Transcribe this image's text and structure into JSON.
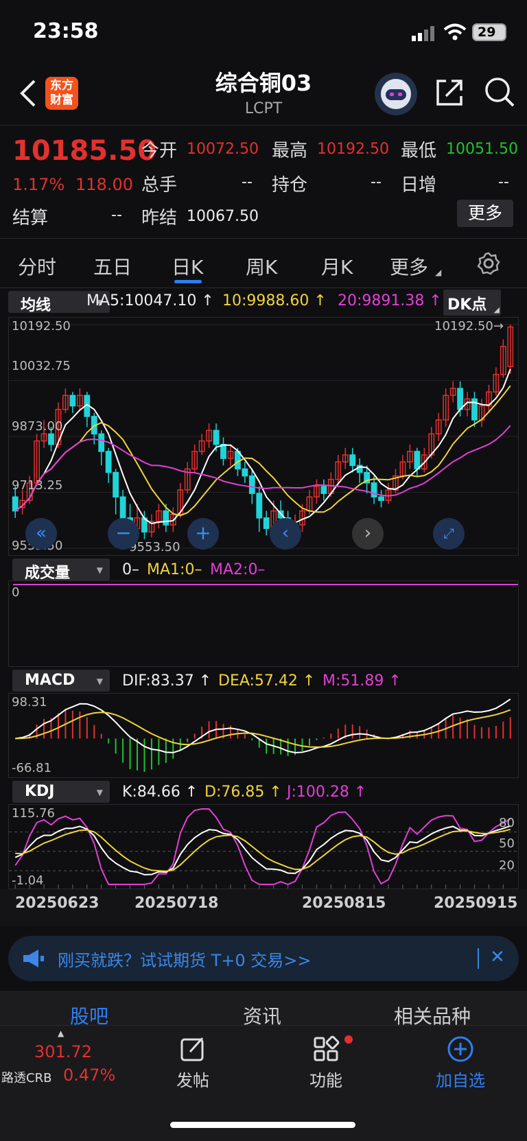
{
  "status": {
    "time": "23:58",
    "battery": "29"
  },
  "header": {
    "title": "综合铜03",
    "subtitle": "LCPT",
    "logo_line1": "东方",
    "logo_line2": "财富"
  },
  "quote": {
    "price": "10185.50",
    "change_pct": "1.17%",
    "change": "118.00",
    "open_label": "今开",
    "open": "10072.50",
    "high_label": "最高",
    "high": "10192.50",
    "low_label": "最低",
    "low": "10051.50",
    "volume_label": "总手",
    "volume": "--",
    "oi_label": "持仓",
    "oi": "--",
    "daily_inc_label": "日增",
    "daily_inc": "--",
    "settle_label": "结算",
    "settle": "--",
    "prev_settle_label": "昨结",
    "prev_settle": "10067.50",
    "more_label": "更多"
  },
  "tabs": [
    "分时",
    "五日",
    "日K",
    "周K",
    "月K",
    "更多"
  ],
  "active_tab": 2,
  "main_chart": {
    "selector": "均线",
    "ma5": "MA5:10047.10",
    "ma10": "10:9988.60",
    "ma20": "20:9891.38",
    "dk_label": "DK点",
    "y_labels": [
      "10192.50",
      "10032.75",
      "9873.00",
      "9713.25",
      "9553.50"
    ],
    "max_note": "10192.50→",
    "min_note": "←9553.50"
  },
  "volume_panel": {
    "selector": "成交量",
    "v": "0–",
    "ma1": "MA1:0–",
    "ma2": "MA2:0–",
    "y_label": "0"
  },
  "macd_panel": {
    "selector": "MACD",
    "dif": "DIF:83.37",
    "dea": "DEA:57.42",
    "m": "M:51.89",
    "y_top": "98.31",
    "y_bottom": "-66.81"
  },
  "kdj_panel": {
    "selector": "KDJ",
    "k": "K:84.66",
    "d": "D:76.85",
    "j": "J:100.28",
    "y_top": "115.76",
    "y_bottom": "-1.04",
    "levels": [
      "80",
      "50",
      "20"
    ]
  },
  "x_dates": [
    "20250623",
    "20250718",
    "20250815",
    "20250915"
  ],
  "banner": {
    "text": "刚买就跌？试试期货 T+0 交易>>"
  },
  "section_tabs": [
    "股吧",
    "资讯",
    "相关品种"
  ],
  "bottom": {
    "index_value": "301.72",
    "index_name": "路透CRB",
    "index_pct": "0.47%",
    "post": "发帖",
    "func": "功能",
    "add": "加自选"
  },
  "colors": {
    "up": "#e3312e",
    "down": "#21d4d8",
    "ma5": "#ffffff",
    "ma10": "#f0d43a",
    "ma20": "#e23fd7",
    "accent": "#2f7ff0"
  },
  "chart_data": {
    "type": "candlestick",
    "y_range": [
      9553.5,
      10192.5
    ],
    "candles": [
      [
        9700,
        9660,
        9730,
        9640
      ],
      [
        9670,
        9690,
        9720,
        9650
      ],
      [
        9690,
        9740,
        9760,
        9680
      ],
      [
        9740,
        9860,
        9880,
        9730
      ],
      [
        9860,
        9880,
        9920,
        9840
      ],
      [
        9880,
        9850,
        9900,
        9830
      ],
      [
        9850,
        9950,
        9970,
        9840
      ],
      [
        9950,
        9990,
        10010,
        9940
      ],
      [
        9990,
        9960,
        10000,
        9940
      ],
      [
        9960,
        9990,
        10010,
        9950
      ],
      [
        9990,
        9930,
        10000,
        9900
      ],
      [
        9930,
        9880,
        9940,
        9850
      ],
      [
        9880,
        9830,
        9890,
        9790
      ],
      [
        9830,
        9770,
        9840,
        9740
      ],
      [
        9770,
        9700,
        9780,
        9650
      ],
      [
        9700,
        9640,
        9720,
        9590
      ],
      [
        9640,
        9610,
        9680,
        9575
      ],
      [
        9610,
        9640,
        9680,
        9590
      ],
      [
        9640,
        9600,
        9660,
        9580
      ],
      [
        9600,
        9630,
        9650,
        9585
      ],
      [
        9630,
        9660,
        9680,
        9610
      ],
      [
        9660,
        9620,
        9680,
        9600
      ],
      [
        9620,
        9650,
        9670,
        9600
      ],
      [
        9650,
        9720,
        9740,
        9640
      ],
      [
        9720,
        9780,
        9800,
        9710
      ],
      [
        9780,
        9830,
        9850,
        9770
      ],
      [
        9830,
        9860,
        9880,
        9820
      ],
      [
        9860,
        9890,
        9910,
        9840
      ],
      [
        9890,
        9850,
        9910,
        9830
      ],
      [
        9850,
        9810,
        9870,
        9790
      ],
      [
        9810,
        9830,
        9850,
        9790
      ],
      [
        9830,
        9780,
        9840,
        9760
      ],
      [
        9780,
        9760,
        9800,
        9740
      ],
      [
        9760,
        9710,
        9780,
        9680
      ],
      [
        9710,
        9640,
        9730,
        9600
      ],
      [
        9640,
        9610,
        9660,
        9590
      ],
      [
        9610,
        9660,
        9690,
        9600
      ],
      [
        9660,
        9640,
        9690,
        9610
      ],
      [
        9640,
        9600,
        9660,
        9580
      ],
      [
        9600,
        9620,
        9650,
        9590
      ],
      [
        9620,
        9660,
        9680,
        9600
      ],
      [
        9660,
        9700,
        9720,
        9650
      ],
      [
        9700,
        9730,
        9750,
        9680
      ],
      [
        9730,
        9710,
        9750,
        9690
      ],
      [
        9710,
        9750,
        9770,
        9700
      ],
      [
        9750,
        9800,
        9820,
        9740
      ],
      [
        9800,
        9820,
        9840,
        9780
      ],
      [
        9820,
        9790,
        9840,
        9770
      ],
      [
        9790,
        9770,
        9810,
        9740
      ],
      [
        9770,
        9740,
        9790,
        9710
      ],
      [
        9740,
        9700,
        9760,
        9680
      ],
      [
        9700,
        9690,
        9720,
        9670
      ],
      [
        9690,
        9720,
        9740,
        9680
      ],
      [
        9720,
        9760,
        9780,
        9710
      ],
      [
        9760,
        9800,
        9820,
        9750
      ],
      [
        9800,
        9830,
        9850,
        9780
      ],
      [
        9830,
        9780,
        9840,
        9760
      ],
      [
        9780,
        9820,
        9840,
        9770
      ],
      [
        9820,
        9880,
        9900,
        9810
      ],
      [
        9880,
        9920,
        9940,
        9860
      ],
      [
        9920,
        9990,
        10010,
        9900
      ],
      [
        9990,
        10010,
        10030,
        9970
      ],
      [
        10010,
        9950,
        10030,
        9930
      ],
      [
        9950,
        9980,
        10000,
        9930
      ],
      [
        9980,
        9920,
        10000,
        9900
      ],
      [
        9920,
        9960,
        9980,
        9900
      ],
      [
        9960,
        10000,
        10020,
        9940
      ],
      [
        10000,
        10050,
        10070,
        9990
      ],
      [
        10050,
        10130,
        10150,
        10040
      ],
      [
        10072.5,
        10185.5,
        10192.5,
        10051.5
      ]
    ]
  }
}
